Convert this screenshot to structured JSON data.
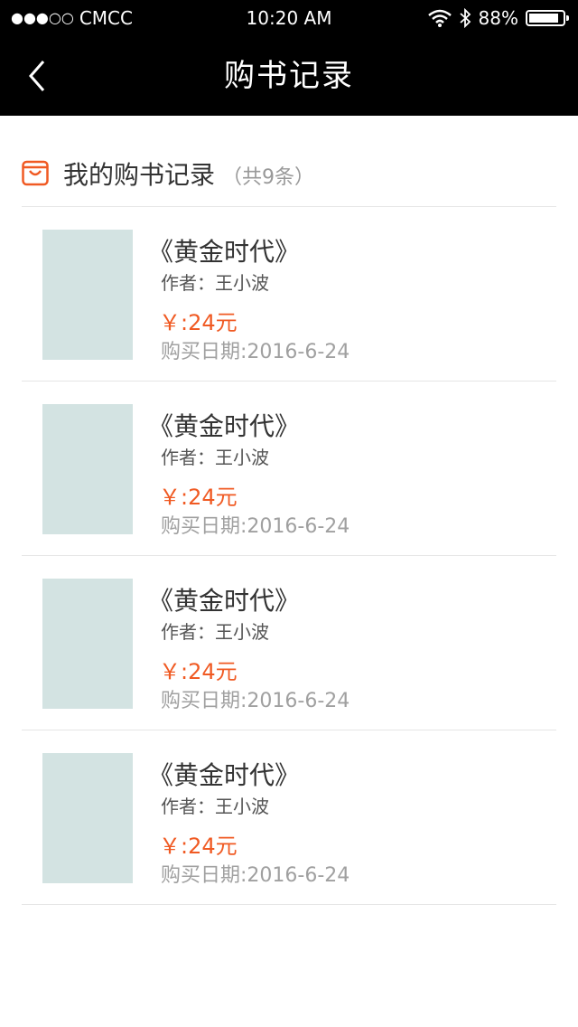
{
  "status_bar": {
    "signal_dots": "●●●○○",
    "carrier": "CMCC",
    "time": "10:20 AM",
    "battery_percent": "88%",
    "battery_level": 0.88
  },
  "nav": {
    "title": "购书记录",
    "back_icon": "chevron-left-icon"
  },
  "section": {
    "icon": "shopping-bag-icon",
    "accent_color": "#f05a23",
    "title": "我的购书记录",
    "count": "（共9条）"
  },
  "records": [
    {
      "title": "《黄金时代》",
      "author": "作者：王小波",
      "price": "￥:24元",
      "date": "购买日期:2016-6-24"
    },
    {
      "title": "《黄金时代》",
      "author": "作者：王小波",
      "price": "￥:24元",
      "date": "购买日期:2016-6-24"
    },
    {
      "title": "《黄金时代》",
      "author": "作者：王小波",
      "price": "￥:24元",
      "date": "购买日期:2016-6-24"
    },
    {
      "title": "《黄金时代》",
      "author": "作者：王小波",
      "price": "￥:24元",
      "date": "购买日期:2016-6-24"
    }
  ]
}
